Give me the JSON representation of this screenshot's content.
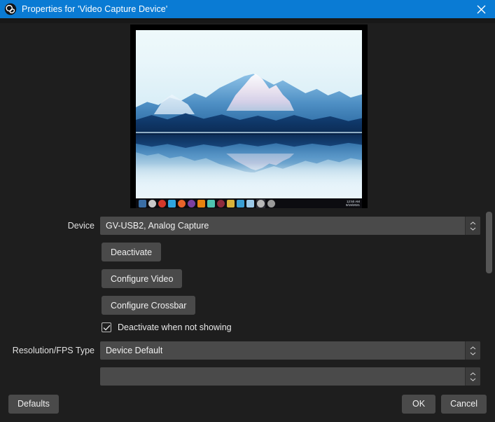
{
  "titlebar": {
    "icon": "obs-logo-icon",
    "title": "Properties for 'Video Capture Device'",
    "close_label": "✕"
  },
  "preview": {
    "name": "video-capture-preview",
    "description": "Captured desktop showing snow-capped mountain reflected in a calm lake, with a Windows taskbar along the bottom",
    "taskbar": {
      "clock_time": "12:50 AM",
      "clock_date": "9/19/2021",
      "icons": [
        {
          "name": "start-button-icon",
          "color": "#3a6ea5"
        },
        {
          "name": "search-icon",
          "color": "#c8c8c8"
        },
        {
          "name": "app-icon-red",
          "color": "#d4392b"
        },
        {
          "name": "app-icon-check",
          "color": "#2fa6e0"
        },
        {
          "name": "app-icon-firefox",
          "color": "#e8642a"
        },
        {
          "name": "app-icon-purple",
          "color": "#7b3fa0"
        },
        {
          "name": "app-icon-orange",
          "color": "#e8830f"
        },
        {
          "name": "app-icon-teal",
          "color": "#4fc3b0"
        },
        {
          "name": "app-icon-maroon",
          "color": "#8e2b3d"
        },
        {
          "name": "app-icon-yellow",
          "color": "#d8b23a"
        },
        {
          "name": "app-icon-blue",
          "color": "#3a9fd4"
        },
        {
          "name": "app-icon-lightblue",
          "color": "#9cc9e8"
        },
        {
          "name": "app-icon-info",
          "color": "#b8b8b8"
        },
        {
          "name": "app-icon-settings",
          "color": "#9a9a9a"
        }
      ]
    }
  },
  "form": {
    "device_label": "Device",
    "device_value": "GV-USB2, Analog Capture",
    "deactivate_button": "Deactivate",
    "configure_video_button": "Configure Video",
    "configure_crossbar_button": "Configure Crossbar",
    "deactivate_checkbox_label": "Deactivate when not showing",
    "deactivate_checkbox_checked": true,
    "resolution_fps_label": "Resolution/FPS Type",
    "resolution_fps_value": "Device Default",
    "next_field_value": ""
  },
  "footer": {
    "defaults_button": "Defaults",
    "ok_button": "OK",
    "cancel_button": "Cancel"
  },
  "colors": {
    "titlebar": "#0a7bd4",
    "dialog_bg": "#1e1e1e",
    "control_bg": "#4a4a4a",
    "text": "#e4e4e4"
  }
}
